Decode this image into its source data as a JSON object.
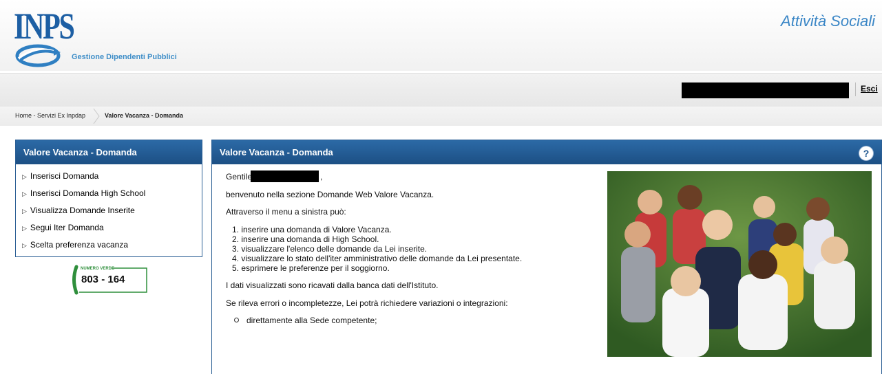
{
  "header": {
    "logo_text": "INPS",
    "logo_subtitle": "Gestione Dipendenti Pubblici",
    "app_title": "Attività Sociali"
  },
  "userbar": {
    "logout_label": "Esci"
  },
  "breadcrumb": {
    "home": "Home - Servizi Ex Inpdap",
    "current": "Valore Vacanza - Domanda"
  },
  "sidebar": {
    "title": "Valore Vacanza - Domanda",
    "items": [
      {
        "label": "Inserisci Domanda"
      },
      {
        "label": "Inserisci Domanda High School"
      },
      {
        "label": "Visualizza Domande Inserite"
      },
      {
        "label": "Segui Iter Domanda"
      },
      {
        "label": "Scelta preferenza vacanza"
      }
    ],
    "numero_verde": {
      "label": "NUMERO VERDE",
      "number": "803 - 164"
    }
  },
  "main": {
    "title": "Valore Vacanza - Domanda",
    "help_icon": "?",
    "greeting": "Gentile",
    "welcome": "benvenuto nella sezione Domande Web Valore Vacanza.",
    "menu_intro": "Attraverso il menu a sinistra può:",
    "list": [
      "1. inserire una domanda di Valore Vacanza.",
      "2. inserire una domanda di High School.",
      "3. visualizzare l'elenco delle domande da Lei inserite.",
      "4. visualizzare lo stato dell'iter amministrativo delle domande da Lei presentate.",
      "5. esprimere le preferenze per il soggiorno."
    ],
    "data_note": "I dati visualizzati sono ricavati dalla banca dati dell'Istituto.",
    "errors_note": "Se rileva errori o incompletezze, Lei potrà richiedere variazioni o integrazioni:",
    "bullets": [
      "direttamente alla Sede competente;"
    ]
  },
  "colors": {
    "brand_blue": "#1d5fa4",
    "panel_header": "#1f578f",
    "numero_verde_green": "#2f8f3c"
  }
}
